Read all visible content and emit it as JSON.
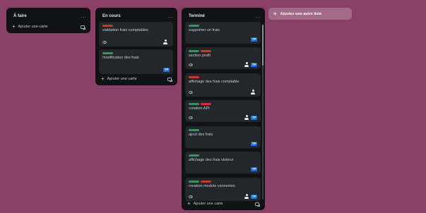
{
  "lists": [
    {
      "title": "À faire",
      "menu": "...",
      "add_card": "Ajouter une carte",
      "cards": []
    },
    {
      "title": "En cours",
      "menu": "...",
      "add_card": "Ajouter une carte",
      "cards": [
        {
          "title": "validation frais comptables",
          "labels": [
            "red"
          ],
          "eye": true,
          "avatar": true,
          "badge": ""
        },
        {
          "title": "modification des frais",
          "labels": [
            "green"
          ],
          "eye": false,
          "avatar": false,
          "badge": "TP"
        }
      ]
    },
    {
      "title": "Terminé",
      "menu": "...",
      "add_card": "Ajouter une carte",
      "cards": [
        {
          "title": "supprimer un frais",
          "labels": [
            "green"
          ],
          "eye": false,
          "avatar": false,
          "badge": "TP"
        },
        {
          "title": "section profil",
          "labels": [
            "green",
            "red"
          ],
          "eye": true,
          "avatar": true,
          "badge": "TP"
        },
        {
          "title": "affichage des frais comptable",
          "labels": [
            "red"
          ],
          "eye": true,
          "avatar": true,
          "badge": ""
        },
        {
          "title": "création API",
          "labels": [
            "green",
            "red"
          ],
          "eye": true,
          "avatar": true,
          "badge": "TP"
        },
        {
          "title": "ajout des frais",
          "labels": [
            "green"
          ],
          "eye": false,
          "avatar": false,
          "badge": "TP"
        },
        {
          "title": "affichage des frais visiteur",
          "labels": [
            "green"
          ],
          "eye": false,
          "avatar": false,
          "badge": "TP"
        },
        {
          "title": "creation module connexion",
          "labels": [
            "green",
            "red"
          ],
          "eye": true,
          "avatar": true,
          "badge": "TP"
        }
      ]
    }
  ],
  "add_list": "Ajoutez une autre liste",
  "colors": {
    "background": "#8a3f66",
    "list": "#111214",
    "card": "#22272b",
    "label_green": "#3f8f5e",
    "label_red": "#c9372c",
    "badge": "#1f6fd1"
  },
  "icons": {
    "add": "plus-icon",
    "template": "template-icon",
    "watch": "eye-icon",
    "member": "avatar-icon"
  }
}
